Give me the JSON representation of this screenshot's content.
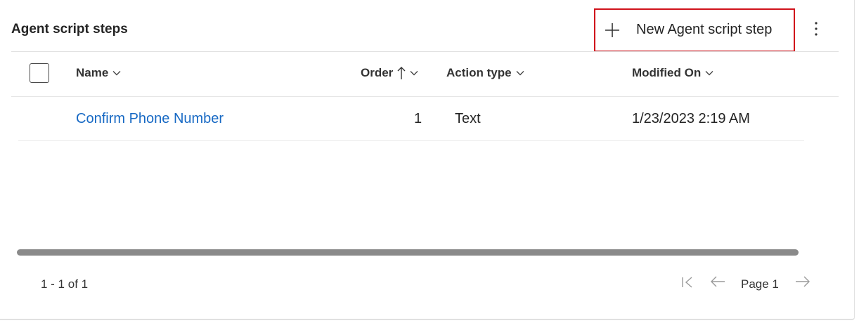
{
  "grid": {
    "title": "Agent script steps",
    "new_button_label": "New Agent script step",
    "columns": [
      {
        "label": "Name"
      },
      {
        "label": "Order",
        "sort": "ascending"
      },
      {
        "label": "Action type"
      },
      {
        "label": "Modified On"
      }
    ],
    "rows": [
      {
        "name": "Confirm Phone Number",
        "order": "1",
        "action_type": "Text",
        "modified_on": "1/23/2023 2:19 AM"
      }
    ]
  },
  "footer": {
    "count_text": "1 - 1 of 1",
    "page_label": "Page 1"
  },
  "colors": {
    "link": "#1769c4",
    "highlight_border": "#d0121b",
    "scrollbar": "#8a8a8a"
  },
  "icons": [
    "plus-icon",
    "more-vertical-icon",
    "chevron-down-icon",
    "sort-ascending-arrow-icon",
    "first-page-icon",
    "previous-page-icon",
    "next-page-icon"
  ]
}
